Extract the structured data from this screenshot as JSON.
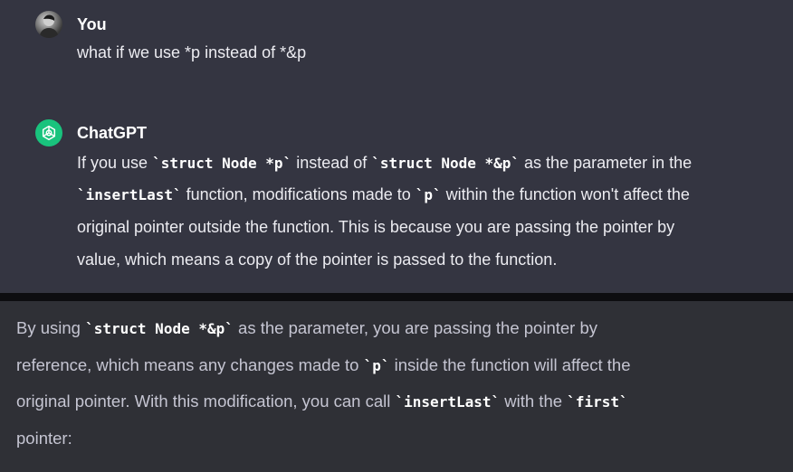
{
  "user_message": {
    "author": "You",
    "text": "what if we use *p instead of *&p"
  },
  "assistant_message": {
    "author": "ChatGPT",
    "line1": {
      "t1": "If you use ",
      "c1": "struct Node *p",
      "t2": " instead of ",
      "c2": "struct Node *&p",
      "t3": " as the parameter in the"
    },
    "line2": {
      "c1": "insertLast",
      "t1": " function, modifications made to ",
      "c2": "p",
      "t2": " within the function won't affect the"
    },
    "line3": "original pointer outside the function. This is because you are passing the pointer by",
    "line4": "value, which means a copy of the pointer is passed to the function."
  },
  "continuation": {
    "line1": {
      "t1": "By using ",
      "c1": "struct Node *&p",
      "t2": " as the parameter, you are passing the pointer by"
    },
    "line2": {
      "t1": "reference, which means any changes made to ",
      "c1": "p",
      "t2": " inside the function will affect the"
    },
    "line3": {
      "t1": "original pointer. With this modification, you can call ",
      "c1": "insertLast",
      "t2": " with the ",
      "c2": "first"
    },
    "line4": "pointer:"
  },
  "icons": {
    "user_avatar": "user-avatar",
    "assistant_avatar": "openai-logo-icon"
  },
  "colors": {
    "panel": "#343541",
    "accent_green": "#19c37d"
  }
}
